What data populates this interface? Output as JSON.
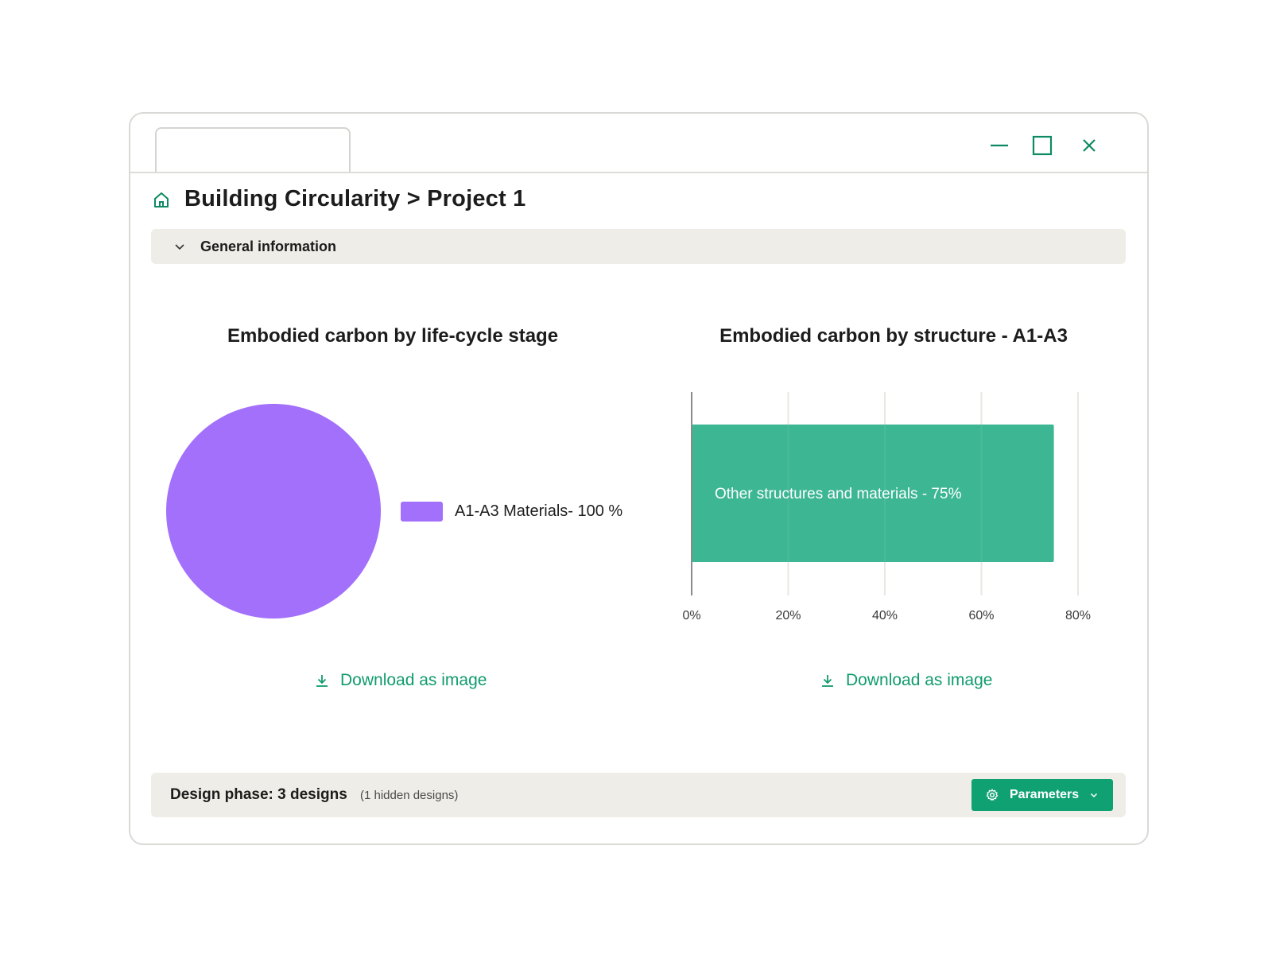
{
  "window": {
    "controls": [
      "minimize-icon",
      "maximize-icon",
      "close-icon"
    ],
    "accent": "#10a173"
  },
  "header": {
    "title": "Building Circularity > Project 1"
  },
  "section": {
    "label": "General information"
  },
  "charts": {
    "pie_title": "Embodied carbon by life-cycle stage",
    "bar_title": "Embodied carbon by structure - A1-A3",
    "pie_legend": "A1-A3 Materials- 100 %",
    "bar_label": "Other structures and materials - 75%",
    "download_label": "Download as image"
  },
  "chart_data": [
    {
      "type": "pie",
      "title": "Embodied carbon by life-cycle stage",
      "slices": [
        {
          "label": "A1-A3 Materials",
          "value": 100,
          "color": "#a370fb"
        }
      ],
      "legend": "right"
    },
    {
      "type": "bar",
      "orientation": "horizontal",
      "title": "Embodied carbon by structure - A1-A3",
      "categories": [
        "Other structures and materials"
      ],
      "values": [
        75
      ],
      "color": "#36b490",
      "xlim": [
        0,
        80
      ],
      "xticks": [
        "0%",
        "20%",
        "40%",
        "60%",
        "80%"
      ],
      "grid": true
    }
  ],
  "footer": {
    "phase_label": "Design phase: 3 designs",
    "hidden_label": "(1 hidden designs)",
    "parameters_label": "Parameters"
  }
}
